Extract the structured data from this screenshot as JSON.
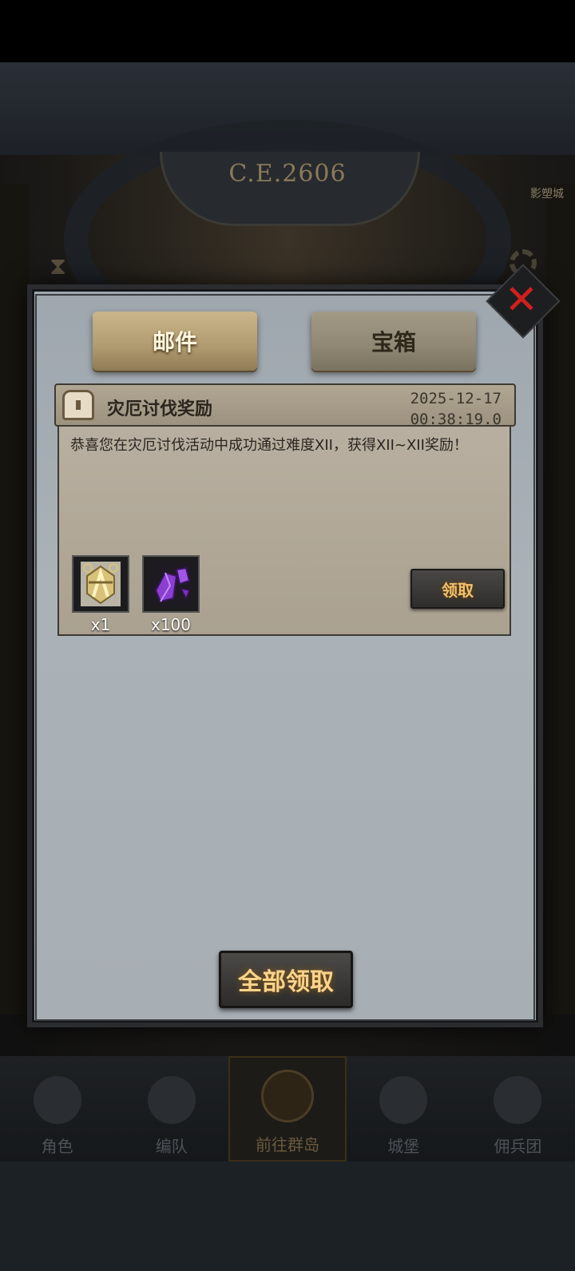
{
  "background": {
    "dial_text": "C.E.2606",
    "side_label": "影塑城"
  },
  "modal": {
    "tabs": [
      {
        "label": "邮件",
        "active": true
      },
      {
        "label": "宝箱",
        "active": false
      }
    ],
    "mail": {
      "title": "灾厄讨伐奖励",
      "date": "2025-12-17",
      "time": "00:38:19.0",
      "body": "恭喜您在灾厄讨伐活动中成功通过难度XII，获得XII~XII奖励！",
      "rewards": [
        {
          "icon": "golden-emblem-icon",
          "quantity": "x1"
        },
        {
          "icon": "purple-crystal-icon",
          "quantity": "x100"
        }
      ],
      "claim_label": "领取"
    },
    "claim_all_label": "全部领取"
  },
  "navbar": {
    "items": [
      {
        "label": "角色",
        "icon": "knight-helmet-icon"
      },
      {
        "label": "编队",
        "icon": "team-icon"
      },
      {
        "label": "前往群岛",
        "icon": "compass-icon",
        "active": true
      },
      {
        "label": "城堡",
        "icon": "castle-icon"
      },
      {
        "label": "佣兵团",
        "icon": "mercenary-icon"
      }
    ]
  },
  "colors": {
    "accent_gold": "#f2c16a",
    "close_red": "#d0201c",
    "panel": "#a7aeb4"
  }
}
